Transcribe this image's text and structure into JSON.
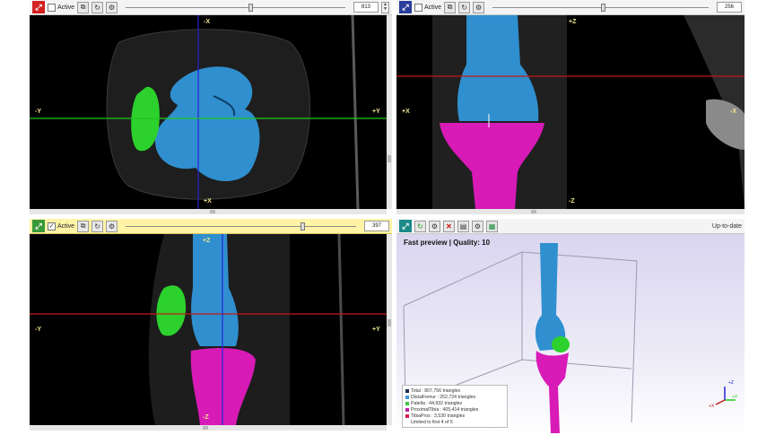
{
  "views": {
    "axial": {
      "active_label": "Active",
      "active_checked": false,
      "slice_value": "813",
      "header_color": "#d42020",
      "axis_labels": {
        "top": "-X",
        "bottom": "+X",
        "left": "-Y",
        "right": "+Y"
      },
      "slider_fraction": 0.56
    },
    "coronal": {
      "active_label": "Active",
      "active_checked": false,
      "slice_value": "256",
      "header_color": "#2a3f9c",
      "axis_labels": {
        "top": "+Z",
        "bottom": "-Z",
        "left": "+X",
        "right": "-X"
      },
      "slider_fraction": 0.5
    },
    "sagittal": {
      "active_label": "Active",
      "active_checked": true,
      "slice_value": "397",
      "header_color": "#3a9a3a",
      "axis_labels": {
        "top": "+Z",
        "bottom": "-Z",
        "left": "-Y",
        "right": "+Y"
      },
      "slider_fraction": 0.76
    }
  },
  "preview": {
    "status_text": "Up-to-date",
    "title": "Fast preview | Quality: 10",
    "header_color": "#1d8a8a",
    "legend": [
      {
        "label": "Total : 807,756 triangles",
        "color": "#1e2b4e"
      },
      {
        "label": "DistalFemur : 252,724 triangles",
        "color": "#3c96d8"
      },
      {
        "label": "Patella : 44,932 triangles",
        "color": "#44c444"
      },
      {
        "label": "ProximalTibia : 405,414 triangles",
        "color": "#c020a8"
      },
      {
        "label": "TibiaPros : 3,530 triangles",
        "color": "#d42050"
      },
      {
        "label": "Limited to first 4 of 5",
        "color": ""
      }
    ],
    "axes_labels": {
      "z": "+Z",
      "y": "+Y",
      "x": "+X"
    }
  },
  "colors": {
    "femur": "#2f8fcf",
    "patella": "#2dd12d",
    "tibia": "#d81ab7",
    "crosshair_red": "#c51818",
    "crosshair_green": "#1fc71f",
    "crosshair_blue": "#2323d6"
  }
}
